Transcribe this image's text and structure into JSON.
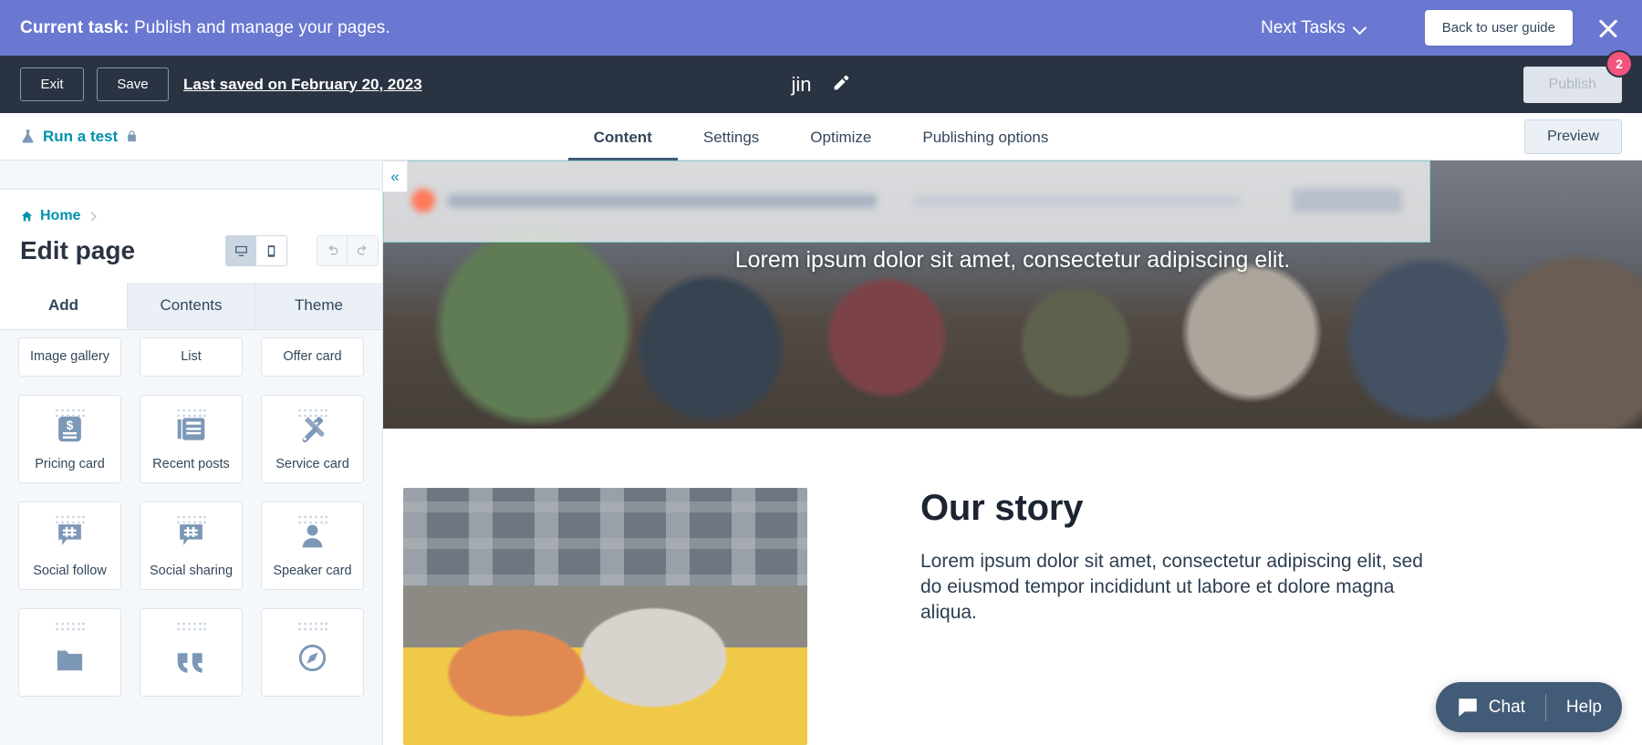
{
  "task_banner": {
    "label": "Current task:",
    "task": "Publish and manage your pages.",
    "next_tasks": "Next Tasks",
    "user_guide_button": "Back to user guide",
    "close_icon": "close-icon",
    "bg_color": "#6a78d1"
  },
  "editor_bar": {
    "exit": "Exit",
    "save": "Save",
    "last_saved": "Last saved on February 20, 2023",
    "page_name": "jin",
    "edit_icon": "pencil-icon",
    "publish": "Publish",
    "publish_badge": "2",
    "badge_color": "#f2547d",
    "bg_color": "#2a3342"
  },
  "tabs_row": {
    "run_test": "Run a test",
    "run_test_icon": "flask-icon",
    "lock_icon": "lock-icon",
    "tabs": [
      {
        "label": "Content",
        "active": true
      },
      {
        "label": "Settings",
        "active": false
      },
      {
        "label": "Optimize",
        "active": false
      },
      {
        "label": "Publishing options",
        "active": false
      }
    ],
    "preview": "Preview",
    "accent_color": "#0091ae"
  },
  "left_panel": {
    "breadcrumb": {
      "home": "Home",
      "home_icon": "home-icon"
    },
    "title": "Edit page",
    "view_toggle": [
      {
        "name": "desktop-view",
        "icon": "desktop-icon",
        "active": true
      },
      {
        "name": "mobile-view",
        "icon": "mobile-icon",
        "active": false
      }
    ],
    "history": [
      {
        "name": "undo-button",
        "icon": "undo-icon"
      },
      {
        "name": "redo-button",
        "icon": "redo-icon"
      }
    ],
    "panel_tabs": [
      {
        "label": "Add",
        "active": true
      },
      {
        "label": "Contents",
        "active": false
      },
      {
        "label": "Theme",
        "active": false
      }
    ],
    "modules": [
      {
        "label": "Image gallery",
        "icon": "image-gallery-icon",
        "clipped": true
      },
      {
        "label": "List",
        "icon": "list-icon",
        "clipped": true
      },
      {
        "label": "Offer card",
        "icon": "offer-card-icon",
        "clipped": true
      },
      {
        "label": "Pricing card",
        "icon": "dollar-card-icon",
        "clipped": false
      },
      {
        "label": "Recent posts",
        "icon": "newspaper-icon",
        "clipped": false
      },
      {
        "label": "Service card",
        "icon": "tools-icon",
        "clipped": false
      },
      {
        "label": "Social follow",
        "icon": "hashtag-bubble-icon",
        "clipped": false
      },
      {
        "label": "Social sharing",
        "icon": "hashtag-bubble-icon",
        "clipped": false
      },
      {
        "label": "Speaker card",
        "icon": "person-icon",
        "clipped": false
      },
      {
        "label": "",
        "icon": "folder-icon",
        "clipped": false
      },
      {
        "label": "",
        "icon": "quote-icon",
        "clipped": false
      },
      {
        "label": "",
        "icon": "compass-icon",
        "clipped": false
      }
    ],
    "collapse_icon": "double-chevron-left-icon"
  },
  "preview": {
    "hero_text": "Lorem ipsum dolor sit amet, consectetur adipiscing elit.",
    "story_title": "Our story",
    "story_body": "Lorem ipsum dolor sit amet, consectetur adipiscing elit, sed do eiusmod tempor incididunt ut labore et dolore magna aliqua.",
    "selected_module_highlight": true
  },
  "chat_widget": {
    "chat": "Chat",
    "help": "Help",
    "chat_icon": "chat-bubble-icon",
    "bg_color": "#425b76"
  }
}
